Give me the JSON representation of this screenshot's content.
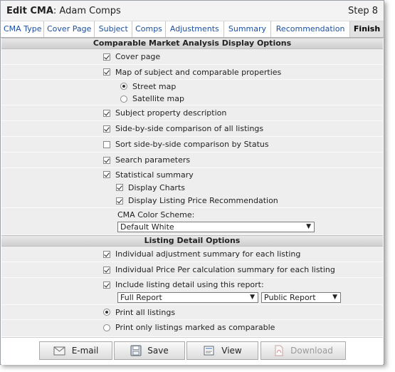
{
  "window": {
    "title_prefix": "Edit CMA",
    "title_name": ": Adam Comps",
    "step": "Step 8"
  },
  "tabs": [
    "CMA Type",
    "Cover Page",
    "Subject",
    "Comps",
    "Adjustments",
    "Summary",
    "Recommendation",
    "Finish"
  ],
  "display_options": {
    "header": "Comparable Market Analysis Display Options",
    "cover_page": "Cover page",
    "map": "Map of subject and comparable properties",
    "street_map": "Street map",
    "satellite_map": "Satellite map",
    "subject_desc": "Subject property description",
    "side_by_side": "Side-by-side comparison of all listings",
    "sort_status": "Sort side-by-side comparison by Status",
    "search_params": "Search parameters",
    "stat_summary": "Statistical summary",
    "display_charts": "Display Charts",
    "display_price_rec": "Display Listing Price Recommendation",
    "color_scheme_label": "CMA Color Scheme:",
    "color_scheme_value": "Default White"
  },
  "listing_options": {
    "header": "Listing Detail Options",
    "adj_summary": "Individual adjustment summary for each listing",
    "price_per": "Individual Price Per calculation summary for each listing",
    "include_detail": "Include listing detail using this report:",
    "report_value": "Full Report",
    "report_type_value": "Public Report",
    "print_all": "Print all listings",
    "print_comparable": "Print only listings marked as comparable"
  },
  "buttons": {
    "email": "E-mail",
    "save": "Save",
    "view": "View",
    "download": "Download"
  }
}
